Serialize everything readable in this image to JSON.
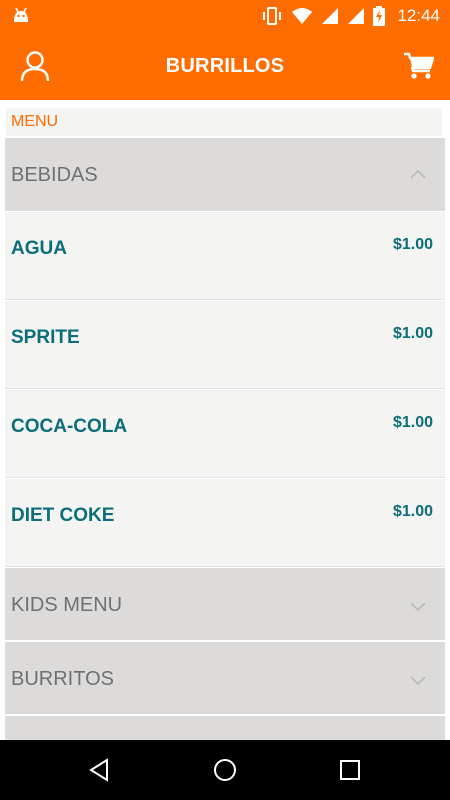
{
  "status_bar": {
    "time": "12:44",
    "icons": [
      "android-icon",
      "vibrate-icon",
      "wifi-icon",
      "signal-icon",
      "signal-icon",
      "battery-charging-icon"
    ]
  },
  "app_bar": {
    "title": "BURRILLOS",
    "left_icon": "profile-icon",
    "right_icon": "cart-icon"
  },
  "colors": {
    "brand": "#ff6d00",
    "item_text": "#0b6e79",
    "category_bg": "#dcdbd9",
    "item_bg": "#f4f4f2"
  },
  "menu": {
    "label": "MENU",
    "categories": [
      {
        "title": "BEBIDAS",
        "expanded": true,
        "items": [
          {
            "name": "AGUA",
            "price": "$1.00"
          },
          {
            "name": "SPRITE",
            "price": "$1.00"
          },
          {
            "name": "COCA-COLA",
            "price": "$1.00"
          },
          {
            "name": "DIET COKE",
            "price": "$1.00"
          }
        ]
      },
      {
        "title": "KIDS MENU",
        "expanded": false
      },
      {
        "title": "BURRITOS",
        "expanded": false
      }
    ]
  },
  "nav_bar": {
    "buttons": [
      "back-icon",
      "home-icon",
      "recents-icon"
    ]
  }
}
